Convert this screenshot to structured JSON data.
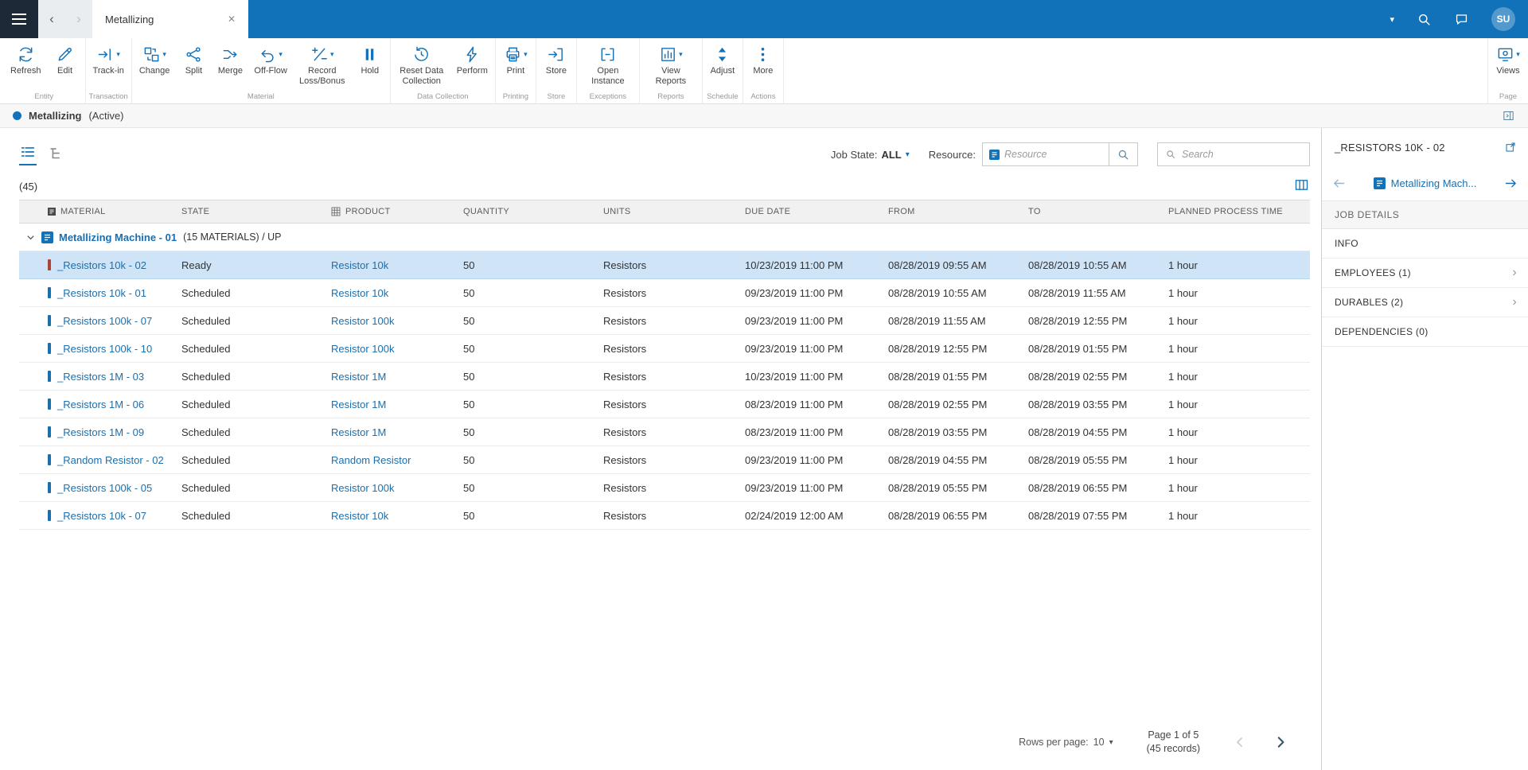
{
  "colors": {
    "accent": "#1172ba",
    "link": "#1b6fae",
    "selected_row_bg": "#cfe4f6",
    "topbar_menu_bg": "#1d2936"
  },
  "topbar": {
    "tab_title": "Metallizing",
    "avatar_initials": "SU"
  },
  "ribbon": {
    "groups": [
      {
        "label": "Entity",
        "buttons": [
          {
            "label": "Refresh",
            "icon": "refresh-icon"
          },
          {
            "label": "Edit",
            "icon": "edit-icon"
          }
        ]
      },
      {
        "label": "Transaction",
        "buttons": [
          {
            "label": "Track-in",
            "icon": "track-in-icon",
            "caret": true
          }
        ]
      },
      {
        "label": "Material",
        "buttons": [
          {
            "label": "Change",
            "icon": "change-icon",
            "caret": true
          },
          {
            "label": "Split",
            "icon": "split-icon"
          },
          {
            "label": "Merge",
            "icon": "merge-icon"
          },
          {
            "label": "Off-Flow",
            "icon": "off-flow-icon",
            "caret": true
          },
          {
            "label": "Record Loss/Bonus",
            "icon": "record-loss-bonus-icon",
            "caret": true
          },
          {
            "label": "Hold",
            "icon": "hold-icon"
          }
        ]
      },
      {
        "label": "Data Collection",
        "buttons": [
          {
            "label": "Reset Data Collection",
            "icon": "reset-data-collection-icon"
          },
          {
            "label": "Perform",
            "icon": "perform-icon"
          }
        ]
      },
      {
        "label": "Printing",
        "buttons": [
          {
            "label": "Print",
            "icon": "print-icon",
            "caret": true
          }
        ]
      },
      {
        "label": "Store",
        "buttons": [
          {
            "label": "Store",
            "icon": "store-icon"
          }
        ]
      },
      {
        "label": "Exceptions",
        "buttons": [
          {
            "label": "Open Instance",
            "icon": "open-instance-icon"
          }
        ]
      },
      {
        "label": "Reports",
        "buttons": [
          {
            "label": "View Reports",
            "icon": "view-reports-icon",
            "caret": true
          }
        ]
      },
      {
        "label": "Schedule",
        "buttons": [
          {
            "label": "Adjust",
            "icon": "adjust-icon"
          }
        ]
      },
      {
        "label": "Actions",
        "buttons": [
          {
            "label": "More",
            "icon": "more-icon"
          }
        ]
      }
    ],
    "page_group": {
      "label": "Page",
      "buttons": [
        {
          "label": "Views",
          "icon": "views-icon",
          "caret": true
        }
      ]
    }
  },
  "page_header": {
    "title": "Metallizing",
    "status": "(Active)"
  },
  "filter_bar": {
    "job_state_label": "Job State:",
    "job_state_value": "ALL",
    "resource_label": "Resource:",
    "resource_placeholder": "Resource",
    "search_placeholder": "Search"
  },
  "table": {
    "record_count": "(45)",
    "columns": [
      {
        "label": "MATERIAL",
        "icon": "material-column-icon"
      },
      {
        "label": "STATE"
      },
      {
        "label": "PRODUCT",
        "icon": "product-column-icon"
      },
      {
        "label": "QUANTITY"
      },
      {
        "label": "UNITS"
      },
      {
        "label": "DUE DATE"
      },
      {
        "label": "FROM"
      },
      {
        "label": "TO"
      },
      {
        "label": "PLANNED PROCESS TIME"
      }
    ],
    "group_row": {
      "name": "Metallizing Machine - 01",
      "details": "(15 MATERIALS) /  UP"
    },
    "rows": [
      {
        "material": "_Resistors 10k - 02",
        "state": "Ready",
        "product": "Resistor 10k",
        "quantity": "50",
        "units": "Resistors",
        "due_date": "10/23/2019 11:00 PM",
        "from": "08/28/2019 09:55 AM",
        "to": "08/28/2019 10:55 AM",
        "planned_time": "1 hour",
        "selected": true,
        "indicator_color": "#a94436"
      },
      {
        "material": "_Resistors 10k - 01",
        "state": "Scheduled",
        "product": "Resistor 10k",
        "quantity": "50",
        "units": "Resistors",
        "due_date": "09/23/2019 11:00 PM",
        "from": "08/28/2019 10:55 AM",
        "to": "08/28/2019 11:55 AM",
        "planned_time": "1 hour",
        "selected": false,
        "indicator_color": "#1b6fae"
      },
      {
        "material": "_Resistors 100k - 07",
        "state": "Scheduled",
        "product": "Resistor 100k",
        "quantity": "50",
        "units": "Resistors",
        "due_date": "09/23/2019 11:00 PM",
        "from": "08/28/2019 11:55 AM",
        "to": "08/28/2019 12:55 PM",
        "planned_time": "1 hour",
        "selected": false,
        "indicator_color": "#1b6fae"
      },
      {
        "material": "_Resistors 100k - 10",
        "state": "Scheduled",
        "product": "Resistor 100k",
        "quantity": "50",
        "units": "Resistors",
        "due_date": "09/23/2019 11:00 PM",
        "from": "08/28/2019 12:55 PM",
        "to": "08/28/2019 01:55 PM",
        "planned_time": "1 hour",
        "selected": false,
        "indicator_color": "#1b6fae"
      },
      {
        "material": "_Resistors 1M - 03",
        "state": "Scheduled",
        "product": "Resistor 1M",
        "quantity": "50",
        "units": "Resistors",
        "due_date": "10/23/2019 11:00 PM",
        "from": "08/28/2019 01:55 PM",
        "to": "08/28/2019 02:55 PM",
        "planned_time": "1 hour",
        "selected": false,
        "indicator_color": "#1b6fae"
      },
      {
        "material": "_Resistors 1M - 06",
        "state": "Scheduled",
        "product": "Resistor 1M",
        "quantity": "50",
        "units": "Resistors",
        "due_date": "08/23/2019 11:00 PM",
        "from": "08/28/2019 02:55 PM",
        "to": "08/28/2019 03:55 PM",
        "planned_time": "1 hour",
        "selected": false,
        "indicator_color": "#1b6fae"
      },
      {
        "material": "_Resistors 1M - 09",
        "state": "Scheduled",
        "product": "Resistor 1M",
        "quantity": "50",
        "units": "Resistors",
        "due_date": "08/23/2019 11:00 PM",
        "from": "08/28/2019 03:55 PM",
        "to": "08/28/2019 04:55 PM",
        "planned_time": "1 hour",
        "selected": false,
        "indicator_color": "#1b6fae"
      },
      {
        "material": "_Random Resistor - 02",
        "state": "Scheduled",
        "product": "Random Resistor",
        "quantity": "50",
        "units": "Resistors",
        "due_date": "09/23/2019 11:00 PM",
        "from": "08/28/2019 04:55 PM",
        "to": "08/28/2019 05:55 PM",
        "planned_time": "1 hour",
        "selected": false,
        "indicator_color": "#1b6fae"
      },
      {
        "material": "_Resistors 100k - 05",
        "state": "Scheduled",
        "product": "Resistor 100k",
        "quantity": "50",
        "units": "Resistors",
        "due_date": "09/23/2019 11:00 PM",
        "from": "08/28/2019 05:55 PM",
        "to": "08/28/2019 06:55 PM",
        "planned_time": "1 hour",
        "selected": false,
        "indicator_color": "#1b6fae"
      },
      {
        "material": "_Resistors 10k - 07",
        "state": "Scheduled",
        "product": "Resistor 10k",
        "quantity": "50",
        "units": "Resistors",
        "due_date": "02/24/2019 12:00 AM",
        "from": "08/28/2019 06:55 PM",
        "to": "08/28/2019 07:55 PM",
        "planned_time": "1 hour",
        "selected": false,
        "indicator_color": "#1b6fae"
      }
    ]
  },
  "pagination": {
    "rows_per_page_label": "Rows per page:",
    "rows_per_page_value": "10",
    "page_info": "Page 1 of 5",
    "record_info": "(45 records)"
  },
  "side_panel": {
    "title": "_RESISTORS 10K - 02",
    "nav_label": "Metallizing Mach...",
    "section_title": "JOB DETAILS",
    "items": [
      {
        "label": "INFO",
        "chevron": false
      },
      {
        "label": "EMPLOYEES (1)",
        "chevron": true
      },
      {
        "label": "DURABLES (2)",
        "chevron": true
      },
      {
        "label": "DEPENDENCIES (0)",
        "chevron": false
      }
    ]
  }
}
